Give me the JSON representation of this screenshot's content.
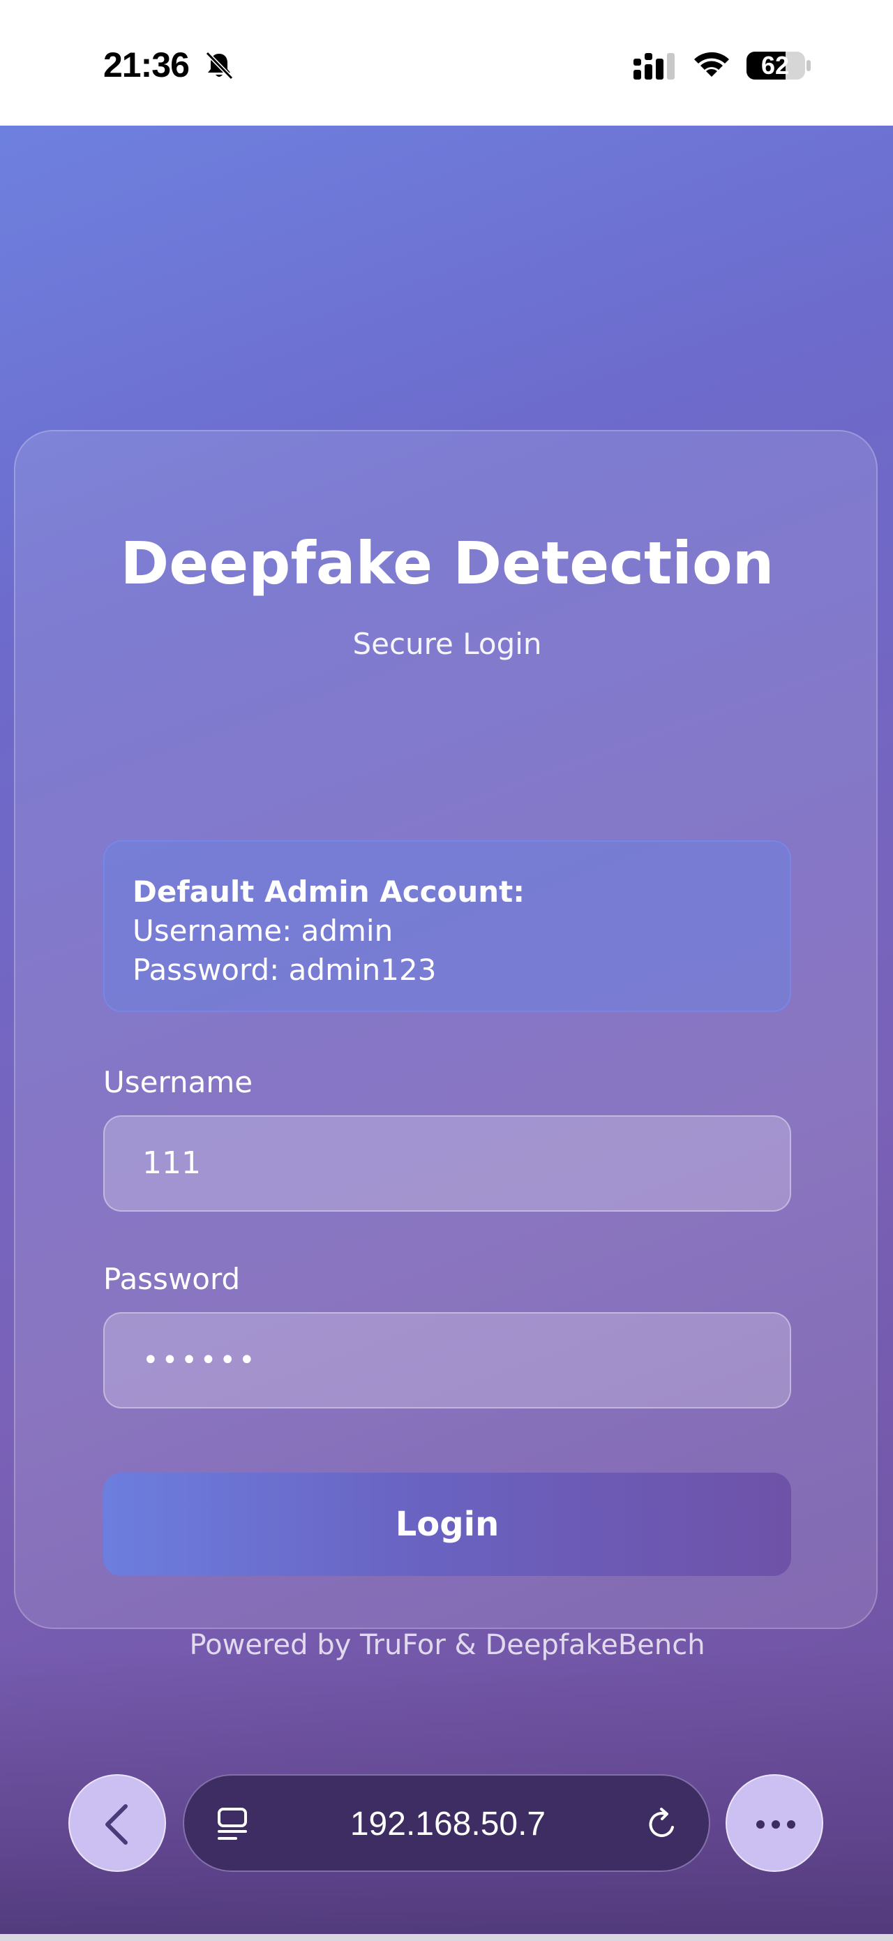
{
  "status_bar": {
    "time": "21:36",
    "battery": "62"
  },
  "card": {
    "title": "Deepfake Detection",
    "subtitle": "Secure Login",
    "info": {
      "title": "Default Admin Account:",
      "username_line": "Username: admin",
      "password_line": "Password: admin123"
    },
    "username_label": "Username",
    "username_value": "111",
    "password_label": "Password",
    "password_value": "••••••",
    "login_label": "Login",
    "powered_by": "Powered by TruFor & DeepfakeBench"
  },
  "browser": {
    "url": "192.168.50.7"
  },
  "icons": {
    "bell": "bell-slash-icon",
    "signal": "cellular-signal-icon",
    "wifi": "wifi-icon",
    "battery": "battery-icon",
    "back": "chevron-left-icon",
    "tabs": "tabs-icon",
    "reload": "reload-icon",
    "more": "more-icon"
  },
  "colors": {
    "gradient_start": "#6e80de",
    "gradient_end": "#6e4e9c",
    "button_start": "#6c7ede",
    "button_end": "#6e52a8"
  }
}
